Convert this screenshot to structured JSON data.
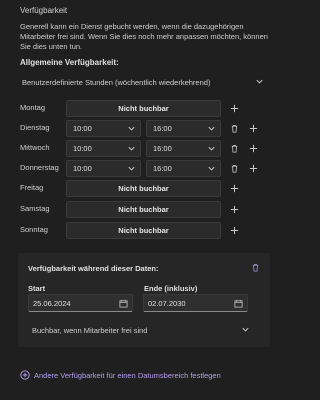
{
  "header": {
    "title": "Verfügbarkeit",
    "description": "Generell kann ein Dienst gebucht werden, wenn die dazugehörigen Mitarbeiter frei sind. Wenn Sie dies noch mehr anpassen möchten, können Sie dies unten tun."
  },
  "general": {
    "label": "Allgemeine Verfügbarkeit:",
    "selected": "Benutzerdefinierte Stunden (wöchentlich wiederkehrend)"
  },
  "days": [
    {
      "day": "Montag",
      "status": "Nicht buchbar"
    },
    {
      "day": "Dienstag",
      "start": "10:00",
      "end": "16:00"
    },
    {
      "day": "Mittwoch",
      "start": "10:00",
      "end": "16:00"
    },
    {
      "day": "Donnerstag",
      "start": "10:00",
      "end": "16:00"
    },
    {
      "day": "Freitag",
      "status": "Nicht buchbar"
    },
    {
      "day": "Samstag",
      "status": "Nicht buchbar"
    },
    {
      "day": "Sonntag",
      "status": "Nicht buchbar"
    }
  ],
  "period": {
    "title": "Verfügbarkeit während dieser Daten:",
    "start_label": "Start",
    "start_value": "25.06.2024",
    "end_label": "Ende (inklusiv)",
    "end_value": "02.07.2030",
    "mode": "Buchbar, wenn Mitarbeiter frei sind"
  },
  "add_link": "Andere Verfügbarkeit für einen Datumsbereich festlegen",
  "colors": {
    "background": "#1f1f1f",
    "accent": "#b4a0f0"
  }
}
